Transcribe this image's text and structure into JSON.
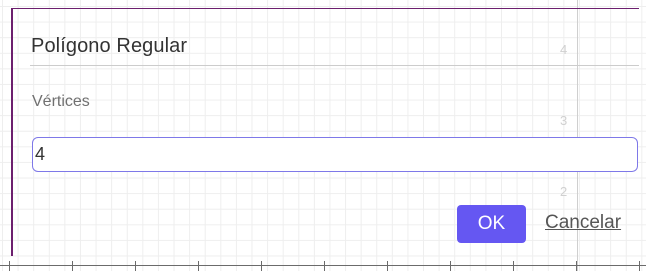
{
  "dialog": {
    "title": "Polígono Regular",
    "field_label": "Vértices",
    "field_value": "4",
    "ok_label": "OK",
    "cancel_label": "Cancelar"
  },
  "graph": {
    "y_axis_labels": [
      "4",
      "3",
      "2"
    ]
  },
  "colors": {
    "accent": "#6557f2",
    "input_border": "#7e78e8",
    "dialog_border": "#6c1f6e"
  }
}
